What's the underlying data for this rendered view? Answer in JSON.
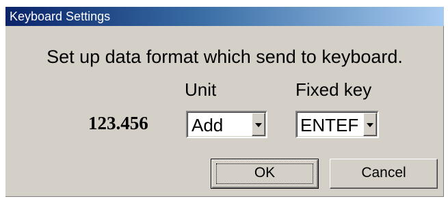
{
  "window": {
    "title": "Keyboard Settings"
  },
  "dialog": {
    "instruction": "Set up data format which send to keyboard.",
    "sample_value": "123.456",
    "unit": {
      "label": "Unit",
      "selected": "Add"
    },
    "fixed_key": {
      "label": "Fixed key",
      "selected": "ENTEF"
    },
    "buttons": {
      "ok": "OK",
      "cancel": "Cancel"
    }
  },
  "colors": {
    "face": "#d4d0c8",
    "title_start": "#0a246a",
    "title_end": "#a6caf0",
    "title_text": "#ffffff"
  },
  "icons": {
    "dropdown": "chevron-down-icon"
  }
}
